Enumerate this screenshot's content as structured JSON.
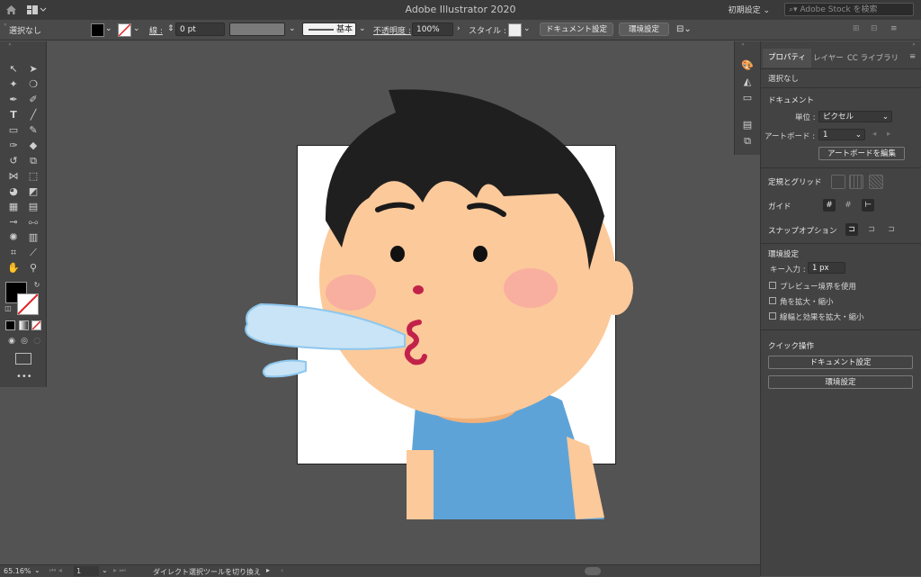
{
  "app": {
    "title": "Adobe Illustrator 2020",
    "workspace": "初期設定",
    "stock_search_placeholder": "Adobe Stock を検索"
  },
  "control_bar": {
    "selection": "選択なし",
    "stroke_label": "線 :",
    "stroke_value": "0 pt",
    "brush_label": "基本",
    "opacity_label": "不透明度 :",
    "opacity_value": "100%",
    "style_label": "スタイル :",
    "document_setup": "ドキュメント設定",
    "preferences": "環境設定"
  },
  "properties": {
    "tabs": [
      "プロパティ",
      "レイヤー",
      "CC ライブラリ"
    ],
    "selection": "選択なし",
    "document_heading": "ドキュメント",
    "unit_label": "単位 :",
    "unit_value": "ピクセル",
    "artboard_label": "アートボード :",
    "artboard_value": "1",
    "edit_artboard": "アートボードを編集",
    "rulers_grids": "定規とグリッド",
    "guides": "ガイド",
    "snap_options": "スナップオプション",
    "preferences_heading": "環境設定",
    "key_increment_label": "キー入力 :",
    "key_increment_value": "1 px",
    "checkboxes": [
      "プレビュー境界を使用",
      "角を拡大・縮小",
      "線幅と効果を拡大・縮小"
    ],
    "quick_actions": "クイック操作",
    "quick_document_setup": "ドキュメント設定",
    "quick_preferences": "環境設定"
  },
  "status_bar": {
    "zoom": "65.16%",
    "artboard": "1",
    "tool_hint": "ダイレクト選択ツールを切り換え"
  },
  "colors": {
    "background": "#535353",
    "panel": "#434343",
    "skin": "#fcc99a",
    "hair": "#222222",
    "shirt": "#5ea3d8",
    "water": "#c8e4f6"
  }
}
